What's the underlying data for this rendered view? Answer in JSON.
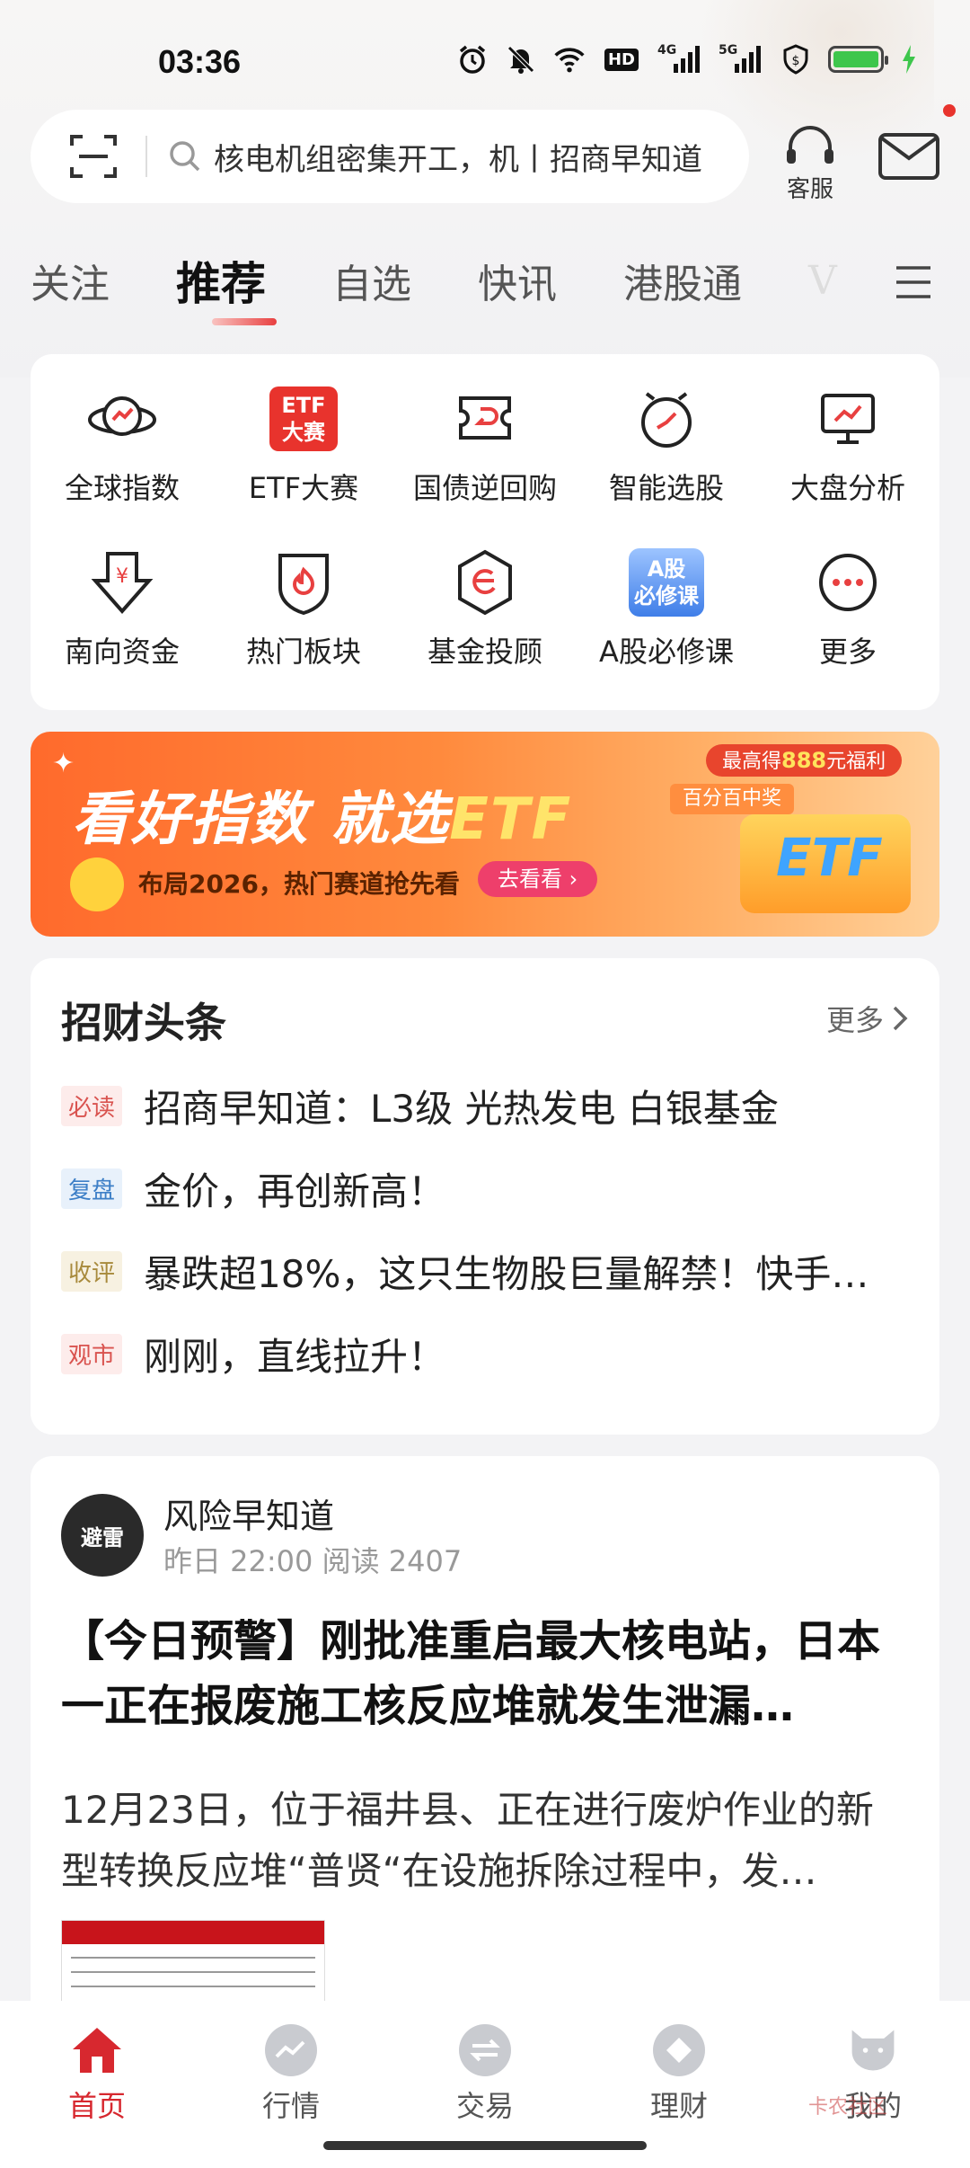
{
  "status_bar": {
    "time": "03:36",
    "icons": [
      "alarm-icon",
      "mute-icon",
      "wifi-icon",
      "hd-icon",
      "4g-signal-icon",
      "5g-signal-icon",
      "shield-icon",
      "battery-icon",
      "charging-icon"
    ],
    "hd_label": "HD",
    "net1": "4G",
    "net2": "5G"
  },
  "search": {
    "text": "核电机组密集开工，机丨招商早知道",
    "customer_service_label": "客服"
  },
  "tabs": [
    {
      "label": "关注"
    },
    {
      "label": "推荐",
      "active": true
    },
    {
      "label": "自选"
    },
    {
      "label": "快讯"
    },
    {
      "label": "港股通"
    },
    {
      "label": "V"
    }
  ],
  "quick_grid": [
    {
      "label": "全球指数",
      "icon": "globe-chart-icon"
    },
    {
      "label": "ETF大赛",
      "icon": "etf-contest-icon",
      "icon_text_1": "ETF",
      "icon_text_2": "大赛"
    },
    {
      "label": "国债逆回购",
      "icon": "bond-repo-icon"
    },
    {
      "label": "智能选股",
      "icon": "smart-pick-icon"
    },
    {
      "label": "大盘分析",
      "icon": "market-analysis-icon"
    },
    {
      "label": "南向资金",
      "icon": "southbound-funds-icon"
    },
    {
      "label": "热门板块",
      "icon": "hot-sector-icon"
    },
    {
      "label": "基金投顾",
      "icon": "fund-advisor-icon"
    },
    {
      "label": "A股必修课",
      "icon": "a-share-course-icon",
      "icon_text_1": "A股",
      "icon_text_2": "必修课"
    },
    {
      "label": "更多",
      "icon": "more-icon"
    }
  ],
  "banner": {
    "title_part1": "看好指数 就选",
    "title_part2": "ETF",
    "subtitle": "布局2026，热门赛道抢先看",
    "button": "去看看 ›",
    "badge_prefix": "最高得",
    "badge_amount": "888",
    "badge_suffix": "元福利",
    "badge2": "百分百中奖",
    "box_text": "ETF"
  },
  "headlines": {
    "title": "招财头条",
    "more": "更多",
    "items": [
      {
        "tag": "必读",
        "text": "招商早知道：L3级 光热发电 白银基金",
        "tag_color": "#d9534f",
        "tag_bg": "#fdeceb"
      },
      {
        "tag": "复盘",
        "text": "金价，再创新高！",
        "tag_color": "#3d7fc7",
        "tag_bg": "#e8f1fb"
      },
      {
        "tag": "收评",
        "text": "暴跌超18%，这只生物股巨量解禁！快手…",
        "tag_color": "#a88a3c",
        "tag_bg": "#f7f1e1"
      },
      {
        "tag": "观市",
        "text": "刚刚，直线拉升！",
        "tag_color": "#d9534f",
        "tag_bg": "#fdeceb"
      }
    ]
  },
  "article": {
    "avatar_text": "避雷",
    "author": "风险早知道",
    "meta": "昨日 22:00   阅读 2407",
    "headline": "【今日预警】刚批准重启最大核电站，日本一正在报废施工核反应堆就发生泄漏…",
    "body": "12月23日，位于福井县、正在进行废炉作业的新型转换反应堆“普贤“在设施拆除过程中，发…"
  },
  "bottom_nav": [
    {
      "label": "首页",
      "icon": "home-icon",
      "active": true
    },
    {
      "label": "行情",
      "icon": "market-icon"
    },
    {
      "label": "交易",
      "icon": "trade-icon"
    },
    {
      "label": "理财",
      "icon": "wealth-icon"
    },
    {
      "label": "我的",
      "icon": "profile-icon"
    }
  ],
  "watermark": "卡农社区",
  "colors": {
    "brand_red": "#d7282f",
    "banner_orange": "#ff6a2c"
  }
}
